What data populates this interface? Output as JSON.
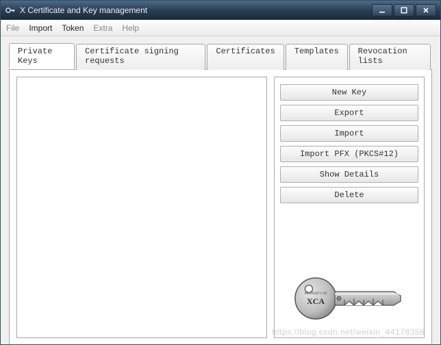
{
  "window": {
    "title": "X Certificate and Key management"
  },
  "menu": {
    "file": "File",
    "import": "Import",
    "token": "Token",
    "extra": "Extra",
    "help": "Help"
  },
  "tabs": {
    "private_keys": "Private Keys",
    "csr": "Certificate signing requests",
    "certificates": "Certificates",
    "templates": "Templates",
    "revocation": "Revocation lists"
  },
  "buttons": {
    "new_key": "New Key",
    "export": "Export",
    "import": "Import",
    "import_pfx": "Import PFX (PKCS#12)",
    "show_details": "Show Details",
    "delete": "Delete"
  },
  "keylogo": {
    "line1": "PROPERTY OF",
    "line2": "XCA"
  },
  "watermark": "https://blog.csdn.net/weixin_44178358"
}
